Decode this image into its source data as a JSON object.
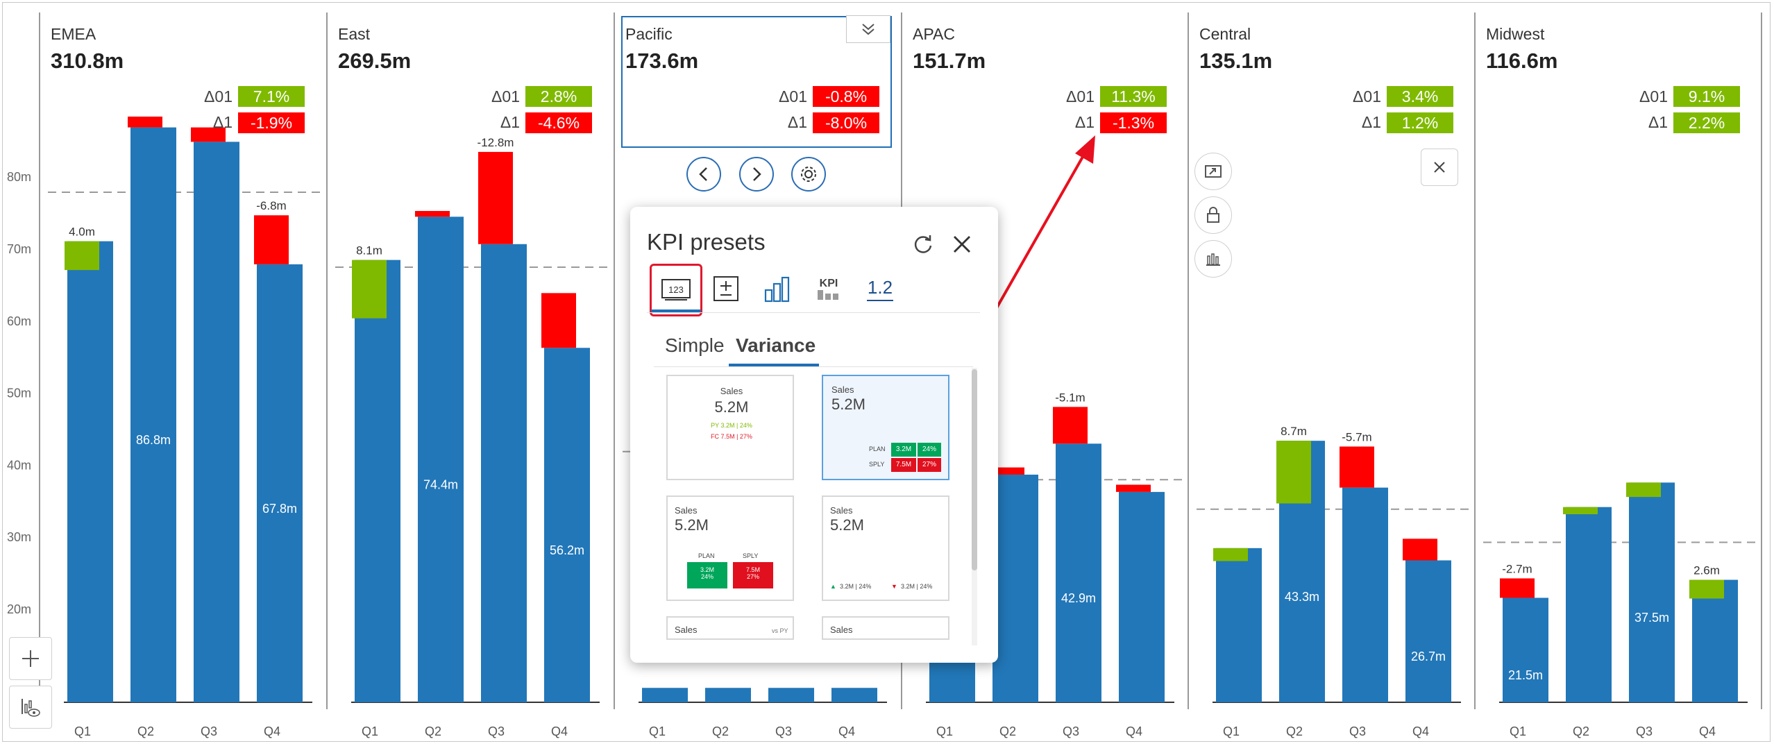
{
  "chart_data": {
    "type": "bar",
    "categories": [
      "Q1",
      "Q2",
      "Q3",
      "Q4"
    ],
    "y_ticks": [
      "20m",
      "30m",
      "40m",
      "50m",
      "60m",
      "70m",
      "80m"
    ],
    "ylim": [
      7,
      91
    ],
    "colors": {
      "bar": "#2277b8",
      "positive": "#7fba00",
      "negative": "#ff0000",
      "reference": "#999999",
      "axis": "#333333"
    },
    "panels": [
      {
        "region": "EMEA",
        "total": "310.8m",
        "d01": "7.1%",
        "d01_sign": "positive",
        "d1": "-1.9%",
        "d1_sign": "negative",
        "values": [
          71.0,
          86.8,
          84.8,
          67.8
        ],
        "deltas": [
          4.0,
          1.5,
          2.0,
          6.8
        ],
        "delta_signs": [
          "positive",
          "negative",
          "negative",
          "negative"
        ],
        "reference": 77.8,
        "top_labels": [
          "4.0m",
          "",
          "",
          "-6.8m"
        ],
        "inner_labels": [
          "",
          "86.8m",
          "",
          "67.8m"
        ]
      },
      {
        "region": "East",
        "total": "269.5m",
        "d01": "2.8%",
        "d01_sign": "positive",
        "d1": "-4.6%",
        "d1_sign": "negative",
        "values": [
          68.4,
          74.4,
          70.6,
          56.2
        ],
        "deltas": [
          8.1,
          0.8,
          12.8,
          7.6
        ],
        "delta_signs": [
          "positive",
          "negative",
          "negative",
          "negative"
        ],
        "reference": 67.4,
        "top_labels": [
          "8.1m",
          "",
          "-12.8m",
          ""
        ],
        "inner_labels": [
          "",
          "74.4m",
          "",
          "56.2m"
        ]
      },
      {
        "region": "Pacific",
        "total": "173.6m",
        "d01": "-0.8%",
        "d01_sign": "negative",
        "d1": "-8.0%",
        "d1_sign": "negative",
        "values": [
          9.0,
          9.0,
          9.0,
          9.0
        ],
        "deltas": [
          0,
          0,
          0,
          0
        ],
        "delta_signs": [
          "positive",
          "positive",
          "positive",
          "positive"
        ],
        "reference": 41.8,
        "top_labels": [
          "",
          "",
          "",
          ""
        ],
        "inner_labels": [
          "",
          "",
          "",
          ""
        ]
      },
      {
        "region": "APAC",
        "total": "151.7m",
        "d01": "11.3%",
        "d01_sign": "positive",
        "d1": "-1.3%",
        "d1_sign": "negative",
        "values": [
          38.0,
          38.6,
          42.9,
          36.2
        ],
        "deltas": [
          0,
          1.0,
          5.1,
          1.0
        ],
        "delta_signs": [
          "positive",
          "negative",
          "negative",
          "negative"
        ],
        "reference": 37.9,
        "top_labels": [
          "",
          "",
          "-5.1m",
          ""
        ],
        "inner_labels": [
          "",
          "",
          "42.9m",
          ""
        ]
      },
      {
        "region": "Central",
        "total": "135.1m",
        "d01": "3.4%",
        "d01_sign": "positive",
        "d1": "1.2%",
        "d1_sign": "positive",
        "values": [
          28.4,
          43.3,
          36.8,
          26.7
        ],
        "deltas": [
          1.8,
          8.7,
          5.7,
          3.0
        ],
        "delta_signs": [
          "positive",
          "positive",
          "negative",
          "negative"
        ],
        "reference": 33.8,
        "top_labels": [
          "",
          "8.7m",
          "-5.7m",
          ""
        ],
        "inner_labels": [
          "",
          "43.3m",
          "",
          "26.7m"
        ]
      },
      {
        "region": "Midwest",
        "total": "116.6m",
        "d01": "9.1%",
        "d01_sign": "positive",
        "d1": "2.2%",
        "d1_sign": "positive",
        "values": [
          21.5,
          34.1,
          37.5,
          24.0
        ],
        "deltas": [
          2.7,
          1.0,
          2.0,
          2.6
        ],
        "delta_signs": [
          "negative",
          "positive",
          "positive",
          "positive"
        ],
        "reference": 29.2,
        "top_labels": [
          "-2.7m",
          "",
          "",
          "2.6m"
        ],
        "inner_labels": [
          "21.5m",
          "",
          "37.5m",
          ""
        ]
      }
    ]
  },
  "labels": {
    "d01": "Δ01",
    "d1": "Δ1"
  },
  "popup": {
    "title": "KPI presets",
    "tab_kpi": "KPI",
    "tab_decimal": "1.2",
    "tab_numeric": "123",
    "subtab_simple": "Simple",
    "subtab_variance": "Variance",
    "cards": [
      {
        "title": "Sales",
        "value": "5.2M",
        "line1": "PY 3.2M | 24%",
        "line2": "FC 7.5M | 27%"
      },
      {
        "title": "Sales",
        "value": "5.2M",
        "plan_label": "PLAN",
        "plan_val": "3.2M",
        "plan_pct": "24%",
        "sply_label": "SPLY",
        "sply_val": "7.5M",
        "sply_pct": "27%"
      },
      {
        "title": "Sales",
        "value": "5.2M",
        "plan_label": "PLAN",
        "sply_label": "SPLY",
        "plan_val": "3.2M",
        "plan_pct": "24%",
        "sply_val": "7.5M",
        "sply_pct": "27%"
      },
      {
        "title": "Sales",
        "value": "5.2M",
        "left": "3.2M | 24%",
        "right": "3.2M | 24%"
      },
      {
        "title": "Sales",
        "note": "vs PY"
      },
      {
        "title": "Sales"
      }
    ]
  }
}
